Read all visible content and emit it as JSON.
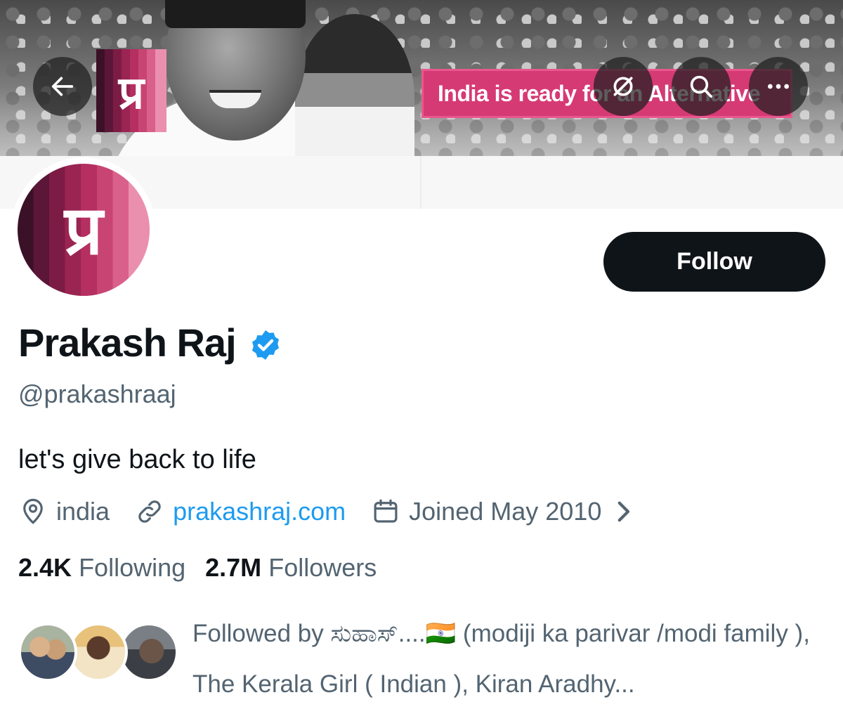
{
  "banner": {
    "logo_glyph": "प्र",
    "slogan": "India is ready for an Alternative"
  },
  "toolbar": {
    "back_icon": "arrow-left-icon",
    "grok_icon": "grok-icon",
    "search_icon": "search-icon",
    "more_icon": "more-icon"
  },
  "profile": {
    "avatar_glyph": "प्र",
    "name": "Prakash Raj",
    "handle": "@prakashraaj",
    "bio": "let's give back to life",
    "location": "india",
    "website": "prakashraj.com",
    "joined": "Joined May 2010",
    "following_count": "2.4K",
    "following_label": "Following",
    "followers_count": "2.7M",
    "followers_label": "Followers",
    "follow_button": "Follow",
    "followed_by": "Followed by ಸುಹಾಸ್....🇮🇳 (modiji ka parivar /modi family ), The Kerala Girl ( Indian ), Kiran Aradhy..."
  },
  "colors": {
    "accent_blue": "#1d9bf0",
    "brand_magenta": "#d63a74",
    "text_primary": "#0f1419",
    "text_secondary": "#536471"
  }
}
